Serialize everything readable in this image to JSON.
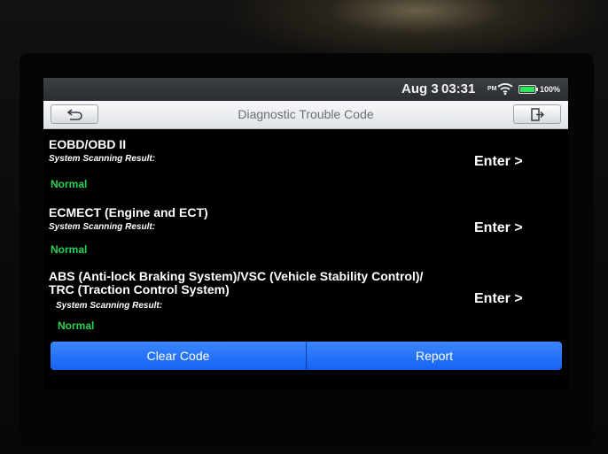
{
  "status_bar": {
    "date": "Aug 3",
    "time": "03:31",
    "ampm": "PM",
    "wifi_icon": "wifi-icon",
    "battery_icon": "battery-icon",
    "battery_level": "100%"
  },
  "header": {
    "title": "Diagnostic Trouble Code",
    "back_icon": "back-arrow-icon",
    "exit_icon": "exit-icon"
  },
  "results": [
    {
      "system": "EOBD/OBD II",
      "label": "System Scanning Result:",
      "status": "Normal",
      "action": "Enter >"
    },
    {
      "system": "ECMECT (Engine and ECT)",
      "label": "System Scanning Result:",
      "status": "Normal",
      "action": "Enter >"
    },
    {
      "system_line1": "ABS (Anti-lock Braking System)/VSC (Vehicle Stability Control)/",
      "system_line2": "TRC (Traction Control System)",
      "label": "System Scanning Result:",
      "status": "Normal",
      "action": "Enter >"
    }
  ],
  "footer": {
    "clear_code": "Clear Code",
    "report": "Report"
  },
  "colors": {
    "status_normal": "#27d256",
    "action_blue": "#1a6cf5",
    "battery_green": "#2ee65a"
  }
}
